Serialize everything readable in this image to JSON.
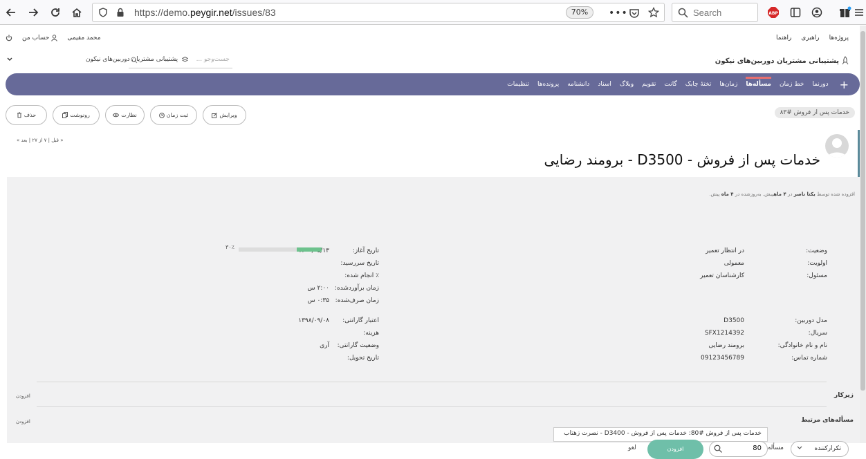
{
  "browser": {
    "url_prefix": "https://demo.",
    "url_domain": "peygir.net",
    "url_path": "/issues/83",
    "zoom": "70%",
    "search_placeholder": "Search",
    "abp_label": "ABP"
  },
  "top_menu": {
    "projects": "پروژه‌ها",
    "admin": "راهبری",
    "help": "راهنما"
  },
  "account_menu": {
    "user": "محمد مقیمی",
    "my_account": "حساب من"
  },
  "header": {
    "project_title": "پشتیبانی مشتریان دوربین‌های نیکون",
    "project_select": "پشتیبانی مشتریان دوربین‌های نیکون",
    "search_placeholder": "جست‌وجو ..."
  },
  "nav": {
    "items": [
      "دورنما",
      "خط زمان",
      "مسأله‌ها",
      "زمان‌ها",
      "تختهٔ چابک",
      "گانت",
      "تقویم",
      "وبلاگ",
      "اسناد",
      "دانشنامه",
      "پرونده‌ها",
      "تنظیمات"
    ],
    "active_index": 2,
    "accent": "#676a99"
  },
  "breadcrumb": "خدمات پس از فروش #۸۳",
  "actions": {
    "edit": "ویرایش",
    "log_time": "ثبت زمان",
    "watch": "نظارت",
    "copy": "رونوشت",
    "delete": "حذف"
  },
  "pager": "« قبل | ۷ از ۲۷ | بعد »",
  "issue": {
    "title": "خدمات پس از فروش - D3500 - برومند رضایی",
    "meta_added": "افزوده شده توسط",
    "meta_author": "یکتا ناصر",
    "meta_in": "در",
    "meta_ago": "۴ ماه",
    "meta_mid": "پیش. به‌روزشده در",
    "meta_updated": "۴ ماه",
    "meta_end": "پیش.",
    "right_attrs": [
      {
        "label": "وضعیت:",
        "value": "در انتظار تعمیر"
      },
      {
        "label": "اولویت:",
        "value": "معمولی"
      },
      {
        "label": "مسئول:",
        "value": "کارشناسان تعمیر"
      }
    ],
    "left_attrs": [
      {
        "label": "تاریخ آغاز:",
        "value": "۱۴۰۰/۰۵/۱۳"
      },
      {
        "label": "تاریخ سررسید:",
        "value": ""
      },
      {
        "label": "٪ انجام شده:",
        "value": ""
      },
      {
        "label": "زمان برآوردشده:",
        "value": "۲:۰۰ س"
      },
      {
        "label": "زمان صرف‌شده:",
        "value": "۰:۳۵ س"
      }
    ],
    "done_ratio": 30,
    "done_label": "۳۰٪",
    "custom_right": [
      {
        "label": "مدل دوربین:",
        "value": "D3500"
      },
      {
        "label": "سریال:",
        "value": "SFX1214392"
      },
      {
        "label": "نام و نام خانوادگی:",
        "value": "برومند رضایی"
      },
      {
        "label": "شماره تماس:",
        "value": "09123456789"
      }
    ],
    "custom_left": [
      {
        "label": "اعتبار گارانتی:",
        "value": "۱۳۹۸/۰۹/۰۸"
      },
      {
        "label": "هزینه:",
        "value": ""
      },
      {
        "label": "وضعیت گارانتی:",
        "value": "آری"
      },
      {
        "label": "تاریخ تحویل:",
        "value": ""
      }
    ]
  },
  "subtasks": {
    "title": "زیرکار",
    "add": "افزودن"
  },
  "relations": {
    "title": "مسأله‌های مرتبط",
    "add": "افزودن",
    "autocomplete": "خدمات پس از فروش #80: خدمات پس از فروش - D3400 - نصرت زهتاب",
    "relation_type": "تکرارکننده",
    "issue_label": "مسأله #",
    "issue_value": "80",
    "submit": "افزودن",
    "cancel": "لغو",
    "submit_color": "#6fbfa9"
  }
}
